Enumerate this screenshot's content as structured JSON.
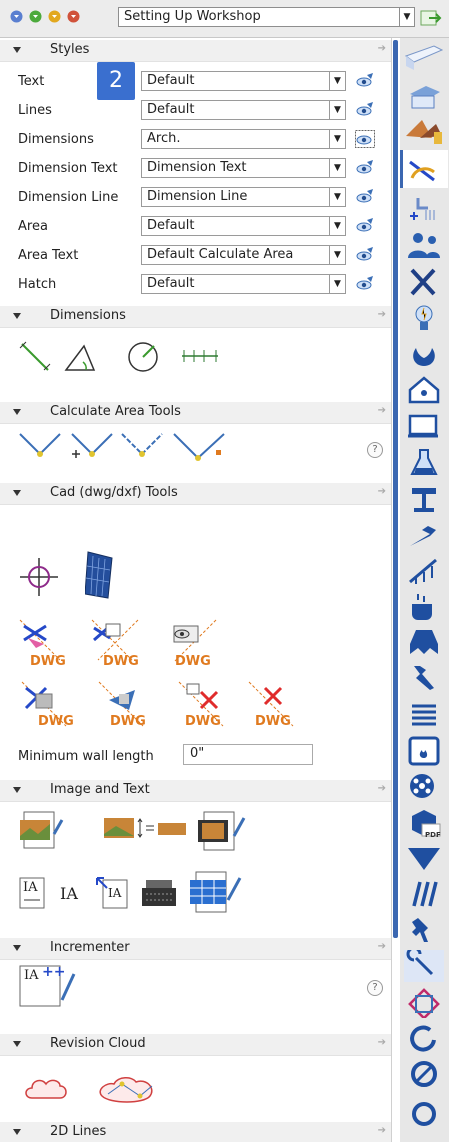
{
  "toolbar": {
    "workshop_select": "Setting Up Workshop"
  },
  "sections": {
    "styles": "Styles",
    "dimensions": "Dimensions",
    "calc_area": "Calculate Area Tools",
    "cad": "Cad (dwg/dxf) Tools",
    "image_text": "Image and Text",
    "incrementer": "Incrementer",
    "revision_cloud": "Revision Cloud",
    "lines2d": "2D Lines"
  },
  "styles": [
    {
      "label": "Text",
      "value": "Default"
    },
    {
      "label": "Lines",
      "value": "Default"
    },
    {
      "label": "Dimensions",
      "value": "Arch."
    },
    {
      "label": "Dimension Text",
      "value": "Dimension Text"
    },
    {
      "label": "Dimension Line",
      "value": "Dimension Line"
    },
    {
      "label": "Area",
      "value": "Default"
    },
    {
      "label": "Area Text",
      "value": "Default Calculate Area"
    },
    {
      "label": "Hatch",
      "value": "Default"
    }
  ],
  "badge": "2",
  "dwg_label": "DWG",
  "help": "?",
  "min_wall": {
    "label": "Minimum wall length",
    "value": "0\""
  },
  "text_tools": {
    "ia": "IA",
    "plus": "++"
  },
  "rightbar_pdf": "PDF",
  "colors": {
    "accent": "#3b67b1",
    "badge": "#3a6fcf",
    "dwg": "#e07a1f"
  }
}
